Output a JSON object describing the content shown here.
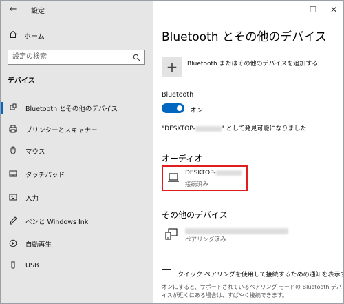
{
  "window": {
    "title": "設定",
    "minimize_glyph": "—",
    "maximize_glyph": "☐",
    "close_glyph": "✕",
    "back_glyph": "←"
  },
  "sidebar": {
    "home_label": "ホーム",
    "search_placeholder": "設定の検索",
    "section_label": "デバイス",
    "items": [
      {
        "label": "Bluetooth とその他のデバイス",
        "icon": "bluetooth-icon",
        "active": true
      },
      {
        "label": "プリンターとスキャナー",
        "icon": "printer-icon",
        "active": false
      },
      {
        "label": "マウス",
        "icon": "mouse-icon",
        "active": false
      },
      {
        "label": "タッチパッド",
        "icon": "touchpad-icon",
        "active": false
      },
      {
        "label": "入力",
        "icon": "keyboard-icon",
        "active": false
      },
      {
        "label": "ペンと Windows Ink",
        "icon": "pen-icon",
        "active": false
      },
      {
        "label": "自動再生",
        "icon": "autoplay-icon",
        "active": false
      },
      {
        "label": "USB",
        "icon": "usb-icon",
        "active": false
      }
    ]
  },
  "main": {
    "page_title": "Bluetooth とその他のデバイス",
    "add_device_label": "Bluetooth またはその他のデバイスを追加する",
    "bluetooth_label": "Bluetooth",
    "toggle_label": "オン",
    "discover_prefix": "\"DESKTOP-",
    "discover_suffix": "\" として発見可能になりました",
    "audio_heading": "オーディオ",
    "audio_device": {
      "name": "DESKTOP-",
      "status": "接続済み"
    },
    "other_heading": "その他のデバイス",
    "other_device": {
      "status": "ペアリング済み"
    },
    "swift_pair_label": "クイック ペアリングを使用して接続するための通知を表示する",
    "swift_pair_note": "オンにすると、サポートされているペアリング モードの Bluetooth デバイスが近くにある場合は、すばやく接続できます。"
  },
  "colors": {
    "accent": "#0067c0",
    "highlight_box": "#e11d1d",
    "sidebar_bg": "#e6e6e6"
  }
}
